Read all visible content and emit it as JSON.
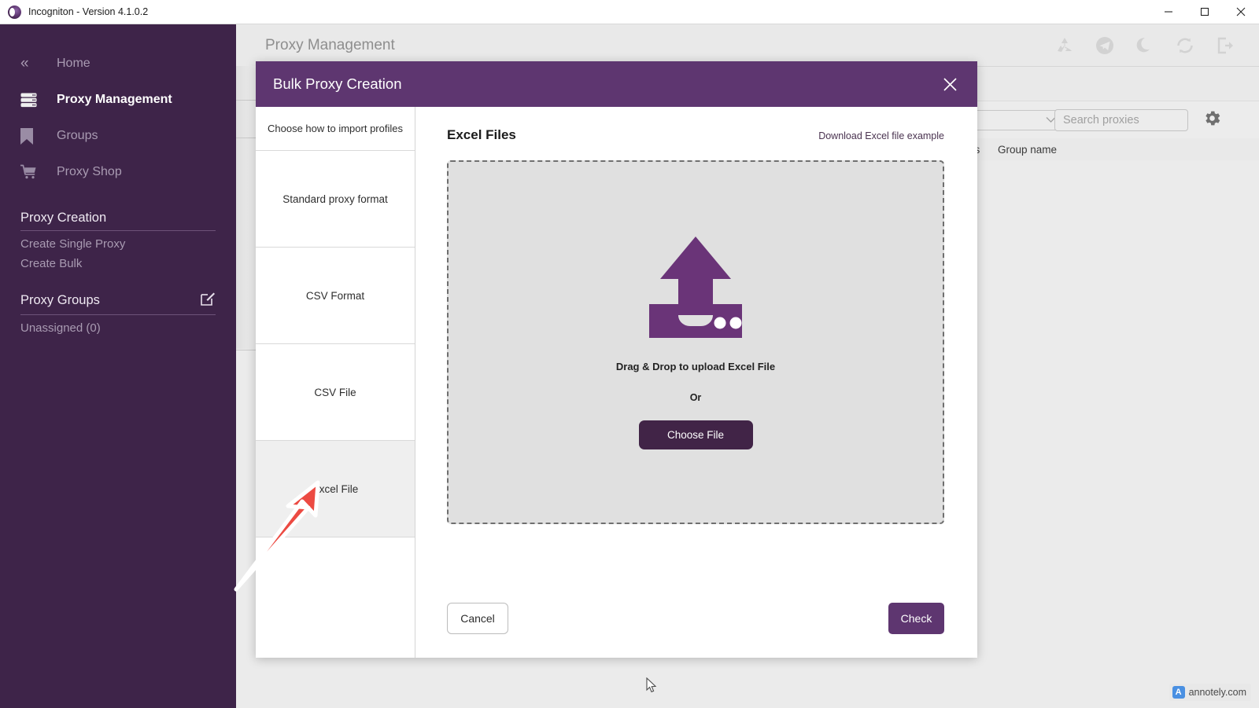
{
  "window": {
    "title": "Incogniton - Version 4.1.0.2",
    "logo_icon": "incogniton-logo",
    "minimize_icon": "minimize-icon",
    "maximize_icon": "maximize-icon",
    "close_icon": "close-icon"
  },
  "sidebar": {
    "collapse_icon": "double-chevron-left-icon",
    "items": [
      {
        "label": "Home",
        "icon": "chevron-collapse-icon",
        "active": false
      },
      {
        "label": "Proxy Management",
        "icon": "server-icon",
        "active": true
      },
      {
        "label": "Groups",
        "icon": "bookmark-icon",
        "active": false
      },
      {
        "label": "Proxy Shop",
        "icon": "cart-icon",
        "active": false
      }
    ],
    "sections": [
      {
        "title": "Proxy Creation",
        "edit_icon": "",
        "links": [
          "Create Single Proxy",
          "Create Bulk"
        ]
      },
      {
        "title": "Proxy Groups",
        "edit_icon": "edit-square-icon",
        "links": [
          "Unassigned (0)"
        ]
      }
    ]
  },
  "main": {
    "page_title": "Proxy Management",
    "header_icons": [
      "recycle-icon",
      "telegram-icon",
      "moon-icon",
      "refresh-icon",
      "logout-icon"
    ],
    "toolbar": {
      "group_select_value": "",
      "group_select_icon": "chevron-down-icon",
      "search_placeholder": "Search proxies",
      "settings_icon": "gear-icon"
    },
    "columns": [
      "iles",
      "Group name"
    ]
  },
  "modal": {
    "title": "Bulk Proxy Creation",
    "close_icon": "close-icon",
    "steps": [
      {
        "label": "Choose how to import profiles",
        "active": false
      },
      {
        "label": "Standard proxy format",
        "active": false
      },
      {
        "label": "CSV Format",
        "active": false
      },
      {
        "label": "CSV File",
        "active": false
      },
      {
        "label": "Excel File",
        "active": true
      }
    ],
    "pane": {
      "title": "Excel Files",
      "download_link": "Download Excel file example",
      "dropzone": {
        "upload_icon": "upload-cloud-icon",
        "drag_text": "Drag & Drop to upload Excel File",
        "or_text": "Or",
        "choose_file_label": "Choose File"
      }
    },
    "footer": {
      "cancel_label": "Cancel",
      "check_label": "Check"
    }
  },
  "annotation": {
    "arrow_icon": "red-arrow-annotation",
    "arrow_color": "#ec4a42"
  },
  "watermark": {
    "mark": "A",
    "text": "annotely.com"
  },
  "cursor": {
    "icon": "mouse-pointer-icon"
  },
  "colors": {
    "sidebar_bg": "#3e2449",
    "modal_header": "#5e3670",
    "accent_button": "#412447",
    "check_button": "#5e3670",
    "dropzone_bg": "#e0e0e0",
    "app_bg": "#e9e9e9",
    "annotation_red": "#ec4a42"
  }
}
